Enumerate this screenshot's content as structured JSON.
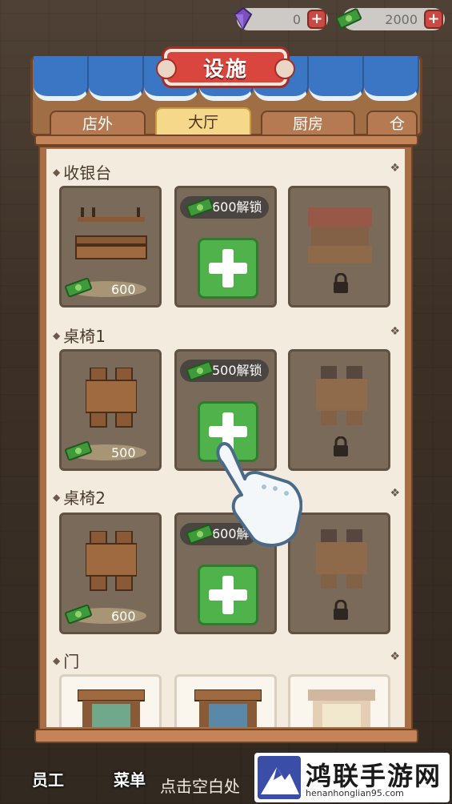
{
  "currency": {
    "gems": "0",
    "cash": "2000",
    "gem_icon": "purple-gem-icon",
    "cash_icon": "green-cash-icon"
  },
  "title": "设施",
  "tabs": [
    {
      "label": "店外"
    },
    {
      "label": "大厅"
    },
    {
      "label": "厨房"
    },
    {
      "label": "仓"
    }
  ],
  "active_tab": "大厅",
  "sections": [
    {
      "title": "收银台",
      "items": [
        {
          "state": "owned",
          "price": "600"
        },
        {
          "state": "unlockable",
          "unlock": "600解锁"
        },
        {
          "state": "locked"
        }
      ]
    },
    {
      "title": "桌椅1",
      "items": [
        {
          "state": "owned",
          "price": "500"
        },
        {
          "state": "unlockable",
          "unlock": "500解锁"
        },
        {
          "state": "locked"
        }
      ]
    },
    {
      "title": "桌椅2",
      "items": [
        {
          "state": "owned",
          "price": "600"
        },
        {
          "state": "unlockable",
          "unlock": "600解"
        },
        {
          "state": "locked"
        }
      ]
    },
    {
      "title": "门",
      "items": [
        {
          "state": "owned"
        },
        {
          "state": "owned"
        },
        {
          "state": "locked"
        }
      ]
    }
  ],
  "bottom": {
    "hint": "点击空白处",
    "nav": [
      {
        "label": "员工"
      },
      {
        "label": "菜单"
      }
    ]
  },
  "watermark": {
    "title": "鸿联手游网",
    "url": "henanhonglian95.com"
  },
  "colors": {
    "awning_blue": "#3a76c4",
    "title_red": "#d9463e",
    "active_tab": "#f5d88a",
    "plus_green": "#4fb24a",
    "panel_bg": "#f3ecde"
  }
}
